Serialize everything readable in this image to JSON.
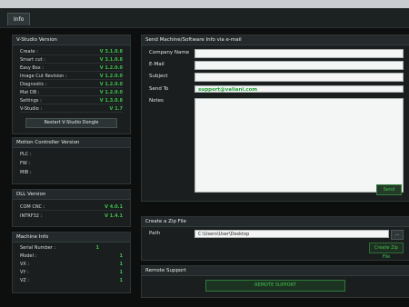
{
  "app": {
    "tab_label": "Info"
  },
  "version_panel": {
    "title": "V-Studio Version",
    "items": [
      {
        "label": "Create :",
        "value": "V 3.1.0.8"
      },
      {
        "label": "Smart cut :",
        "value": "V 3.1.0.8"
      },
      {
        "label": "Easy Box :",
        "value": "V 1.2.0.0"
      },
      {
        "label": "Image Cut Revision :",
        "value": "V 1.2.0.0"
      },
      {
        "label": "Diagnostic :",
        "value": "V 1.2.0.0"
      },
      {
        "label": "Mat DB :",
        "value": "V 1.2.0.0"
      },
      {
        "label": "Settings :",
        "value": "V 1.3.0.8"
      },
      {
        "label": "V-Studio :",
        "value": "V 1.7"
      }
    ],
    "restart_button": "Restart V-Studio Dongle"
  },
  "motion_panel": {
    "title": "Motion Controller Version",
    "items": [
      {
        "label": "PLC :",
        "value": ""
      },
      {
        "label": "FW :",
        "value": ""
      },
      {
        "label": "MIB :",
        "value": ""
      }
    ]
  },
  "dll_panel": {
    "title": "DLL Version",
    "items": [
      {
        "label": "COM CNC :",
        "value": "V 4.0.1"
      },
      {
        "label": "INTRF32 :",
        "value": "V 1.4.1"
      }
    ]
  },
  "machine_panel": {
    "title": "Machine Info",
    "items": [
      {
        "label": "Serial Number :",
        "value": "1"
      },
      {
        "label": "Model :",
        "value": "1"
      },
      {
        "label": "VX :",
        "value": "1"
      },
      {
        "label": "VY :",
        "value": "1"
      },
      {
        "label": "VZ :",
        "value": "1"
      }
    ]
  },
  "email_panel": {
    "title": "Send Machine/Software Info via e-mail",
    "company_label": "Company Name",
    "email_label": "E-Mail",
    "subject_label": "Subject",
    "sendto_label": "Send To",
    "sendto_value": "support@valiani.com",
    "notes_label": "Notes",
    "send_button": "Send"
  },
  "zip_panel": {
    "title": "Create a Zip File",
    "path_label": "Path",
    "path_value": "C:\\Users\\User\\Desktop",
    "browse_button": "...",
    "create_button": "Create Zip File"
  },
  "support_panel": {
    "title": "Remote Support",
    "button": "REMOTE SUPPORT"
  }
}
